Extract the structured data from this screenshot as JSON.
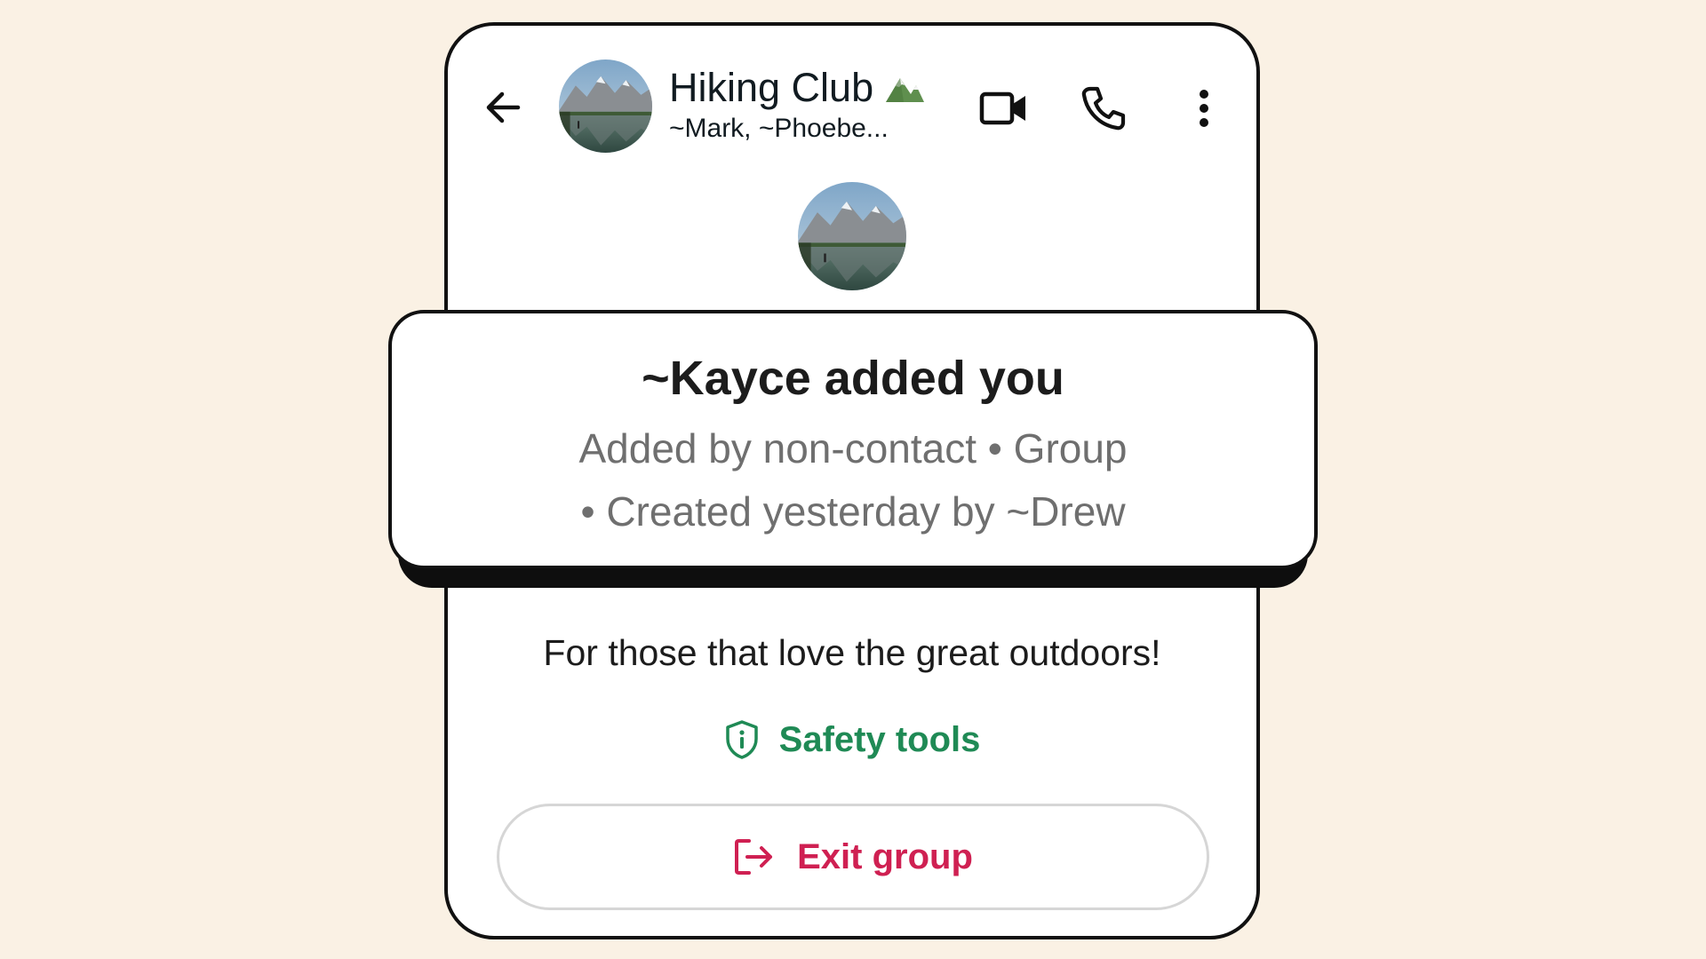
{
  "colors": {
    "background": "#faf1e4",
    "safety_green": "#1f8a55",
    "exit_red": "#cf2052",
    "muted_text": "#6f6f6f"
  },
  "header": {
    "back_icon": "arrow-left-icon",
    "group_name": "Hiking Club",
    "group_emoji": "mountain-icon",
    "members": "~Mark, ~Phoebe...",
    "video_icon": "video-camera-icon",
    "call_icon": "phone-icon",
    "more_icon": "more-vertical-icon"
  },
  "notice": {
    "title": "~Kayce added you",
    "line1": "Added by non-contact • Group",
    "line2": "• Created yesterday by ~Drew"
  },
  "description": "For those that love the great outdoors!",
  "safety": {
    "icon": "shield-info-icon",
    "label": "Safety tools"
  },
  "exit": {
    "icon": "exit-icon",
    "label": "Exit group"
  }
}
